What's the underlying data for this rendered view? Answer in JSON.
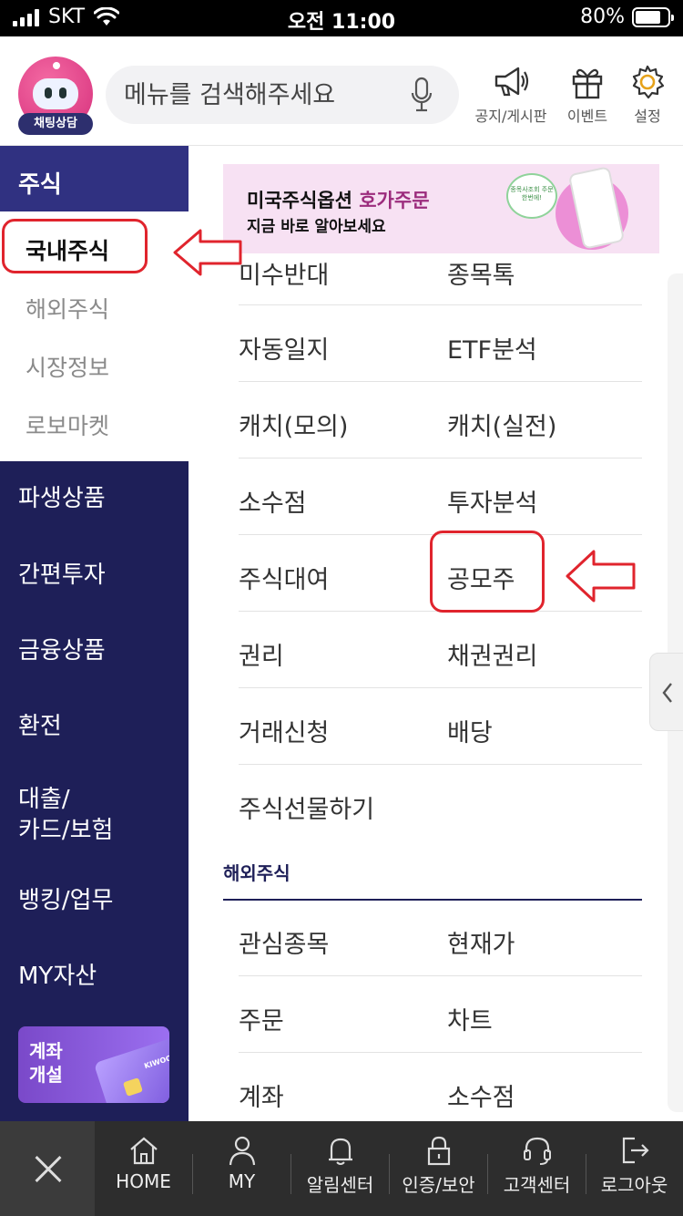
{
  "status": {
    "carrier": "SKT",
    "time": "오전 11:00",
    "battery": "80%",
    "battery_level": 0.8
  },
  "header": {
    "chatbot_label": "채팅상담",
    "search_placeholder": "메뉴를 검색해주세요",
    "icons": [
      {
        "name": "megaphone-icon",
        "label": "공지/게시판"
      },
      {
        "name": "gift-icon",
        "label": "이벤트"
      },
      {
        "name": "gear-icon",
        "label": "설정"
      }
    ]
  },
  "sidebar": {
    "selected": "주식",
    "sub_items": [
      "국내주식",
      "해외주식",
      "시장정보",
      "로보마켓"
    ],
    "items": [
      "파생상품",
      "간편투자",
      "금융상품",
      "환전",
      "대출/\n카드/보험",
      "뱅킹/업무",
      "MY자산"
    ],
    "promo": {
      "line1": "계좌",
      "line2": "개설",
      "card_brand": "KIWOOM"
    }
  },
  "banner": {
    "title_prefix": "미국주식옵션 ",
    "title_highlight": "호가주문",
    "subtitle": "지금 바로 알아보세요",
    "bubble_text": "종목사조회 주문 한번에!"
  },
  "domestic_menu": [
    [
      "미수반대",
      "종목톡"
    ],
    [
      "자동일지",
      "ETF분석"
    ],
    [
      "캐치(모의)",
      "캐치(실전)"
    ],
    [
      "소수점",
      "투자분석"
    ],
    [
      "주식대여",
      "공모주"
    ],
    [
      "권리",
      "채권권리"
    ],
    [
      "거래신청",
      "배당"
    ],
    [
      "주식선물하기",
      ""
    ]
  ],
  "overseas_section": {
    "title": "해외주식",
    "menu": [
      [
        "관심종목",
        "현재가"
      ],
      [
        "주문",
        "차트"
      ],
      [
        "계좌",
        "소수점"
      ]
    ]
  },
  "bottom_bar": [
    "HOME",
    "MY",
    "알림센터",
    "인증/보안",
    "고객센터",
    "로그아웃"
  ],
  "colors": {
    "navy": "#1e1f58",
    "highlight_red": "#e0242d",
    "accent_pink": "#9c2c7d"
  }
}
